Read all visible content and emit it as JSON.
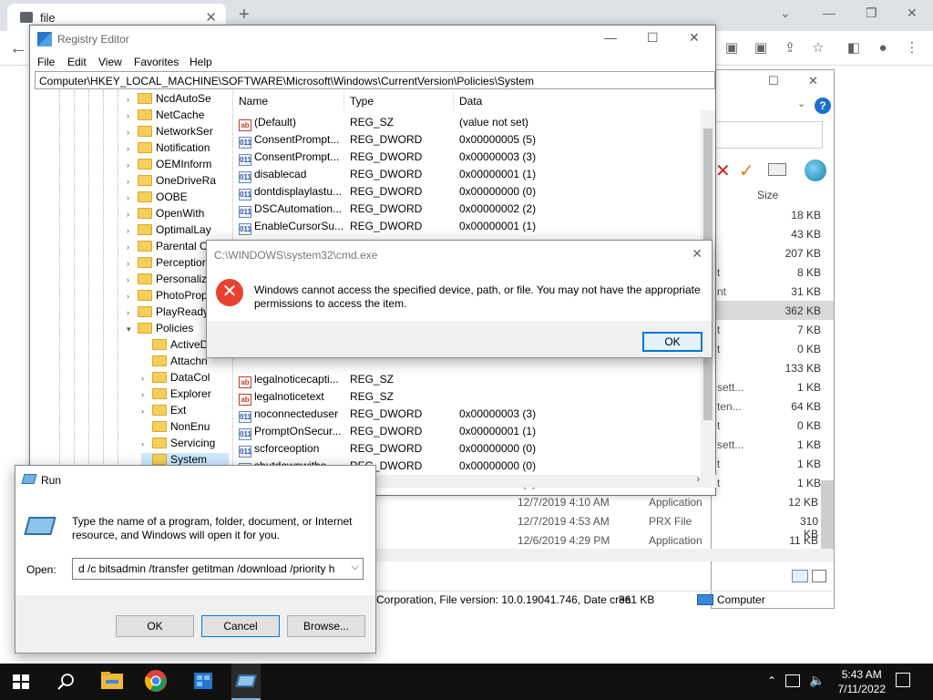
{
  "browser": {
    "tab_title": "file",
    "tab_close": "✕",
    "new_tab": "+"
  },
  "explorer": {
    "size_header": "Size",
    "rows": [
      {
        "left": "",
        "size": "18 KB"
      },
      {
        "left": "",
        "size": "43 KB"
      },
      {
        "left": "",
        "size": "207 KB"
      },
      {
        "left": "t",
        "size": "8 KB"
      },
      {
        "left": "nt",
        "size": "31 KB"
      },
      {
        "left": "",
        "size": "362 KB"
      },
      {
        "left": "t",
        "size": "7 KB"
      },
      {
        "left": "t",
        "size": "0 KB"
      },
      {
        "left": "",
        "size": "133 KB"
      },
      {
        "left": "sett...",
        "size": "1 KB"
      },
      {
        "left": "ten...",
        "size": "64 KB"
      },
      {
        "left": "t",
        "size": "0 KB"
      },
      {
        "left": "sett...",
        "size": "1 KB"
      },
      {
        "left": "t",
        "size": "1 KB"
      },
      {
        "left": "t",
        "size": "1 KB"
      }
    ],
    "files": [
      {
        "date": "12/7/2019 4:10 AM",
        "type": "Application",
        "size": "12 KB"
      },
      {
        "date": "12/7/2019 4:53 AM",
        "type": "PRX File",
        "size": "310 KB"
      },
      {
        "date": "12/6/2019 4:29 PM",
        "type": "Application",
        "size": "11 KB"
      }
    ],
    "status_text": "Corporation, File version: 10.0.19041.746, Date crea",
    "status_size": "361 KB",
    "status_location": "Computer"
  },
  "regedit": {
    "title": "Registry Editor",
    "menu": [
      "File",
      "Edit",
      "View",
      "Favorites",
      "Help"
    ],
    "address": "Computer\\HKEY_LOCAL_MACHINE\\SOFTWARE\\Microsoft\\Windows\\CurrentVersion\\Policies\\System",
    "tree": [
      "NcdAutoSe",
      "NetCache",
      "NetworkSer",
      "Notification",
      "OEMInform",
      "OneDriveRa",
      "OOBE",
      "OpenWith",
      "OptimalLay",
      "Parental C",
      "Perception",
      "Personaliz",
      "PhotoProp",
      "PlayReady",
      "Policies"
    ],
    "subtree": [
      "ActiveD",
      "Attachn",
      "DataCol",
      "Explorer",
      "Ext",
      "NonEnu",
      "Servicing",
      "System"
    ],
    "columns": [
      "Name",
      "Type",
      "Data"
    ],
    "values_top": [
      {
        "icon": "ab",
        "name": "(Default)",
        "type": "REG_SZ",
        "data": "(value not set)"
      },
      {
        "icon": "011",
        "name": "ConsentPrompt...",
        "type": "REG_DWORD",
        "data": "0x00000005 (5)"
      },
      {
        "icon": "011",
        "name": "ConsentPrompt...",
        "type": "REG_DWORD",
        "data": "0x00000003 (3)"
      },
      {
        "icon": "011",
        "name": "disablecad",
        "type": "REG_DWORD",
        "data": "0x00000001 (1)"
      },
      {
        "icon": "011",
        "name": "dontdisplaylastu...",
        "type": "REG_DWORD",
        "data": "0x00000000 (0)"
      },
      {
        "icon": "011",
        "name": "DSCAutomation...",
        "type": "REG_DWORD",
        "data": "0x00000002 (2)"
      },
      {
        "icon": "011",
        "name": "EnableCursorSu...",
        "type": "REG_DWORD",
        "data": "0x00000001 (1)"
      }
    ],
    "values_bottom": [
      {
        "icon": "ab",
        "name": "legalnoticecapti...",
        "type": "REG_SZ",
        "data": ""
      },
      {
        "icon": "ab",
        "name": "legalnoticetext",
        "type": "REG_SZ",
        "data": ""
      },
      {
        "icon": "011",
        "name": "noconnecteduser",
        "type": "REG_DWORD",
        "data": "0x00000003 (3)"
      },
      {
        "icon": "011",
        "name": "PromptOnSecur...",
        "type": "REG_DWORD",
        "data": "0x00000001 (1)"
      },
      {
        "icon": "011",
        "name": "scforceoption",
        "type": "REG_DWORD",
        "data": "0x00000000 (0)"
      },
      {
        "icon": "011",
        "name": "shutdownwitho...",
        "type": "REG_DWORD",
        "data": "0x00000000 (0)"
      },
      {
        "icon": "011",
        "name": "",
        "type": "",
        "data": "0x00000001 (1)"
      }
    ]
  },
  "error_dialog": {
    "title": "C:\\WINDOWS\\system32\\cmd.exe",
    "message": "Windows cannot access the specified device, path, or file. You may not have the appropriate permissions to access the item.",
    "ok_label": "OK"
  },
  "run_dialog": {
    "title": "Run",
    "description": "Type the name of a program, folder, document, or Internet resource, and Windows will open it for you.",
    "open_label": "Open:",
    "command": "d /c bitsadmin /transfer getitman /download /priority h",
    "ok_label": "OK",
    "cancel_label": "Cancel",
    "browse_label": "Browse..."
  },
  "taskbar": {
    "time": "5:43 AM",
    "date": "7/11/2022"
  }
}
